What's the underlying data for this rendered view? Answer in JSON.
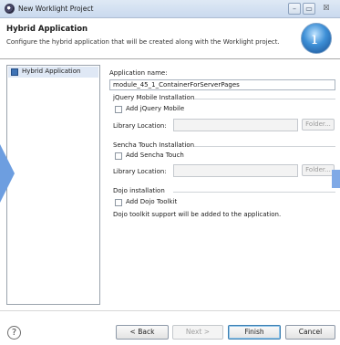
{
  "window": {
    "title": "New Worklight Project",
    "close_glyph": "☒"
  },
  "banner": {
    "title": "Hybrid Application",
    "subtitle": "Configure the hybrid application that will be created along with the Worklight project."
  },
  "sidebar": {
    "items": [
      {
        "label": "Hybrid Application",
        "selected": true
      }
    ]
  },
  "form": {
    "app_name_label": "Application name:",
    "app_name_value": "module_45_1_ContainerForServerPages",
    "jquery": {
      "group_label": "jQuery Mobile Installation",
      "checkbox_label": "Add jQuery Mobile",
      "checked": false,
      "library_label": "Library Location:",
      "library_value": "",
      "folder_label": "Folder..."
    },
    "sencha": {
      "group_label": "Sencha Touch Installation",
      "checkbox_label": "Add Sencha Touch",
      "checked": false,
      "library_label": "Library Location:",
      "library_value": "",
      "folder_label": "Folder..."
    },
    "dojo": {
      "group_label": "Dojo installation",
      "checkbox_label": "Add Dojo Toolkit",
      "checked": false,
      "note": "Dojo toolkit support will be added to the application."
    }
  },
  "buttons": {
    "help": "?",
    "back": "< Back",
    "next": "Next >",
    "finish": "Finish",
    "cancel": "Cancel"
  }
}
